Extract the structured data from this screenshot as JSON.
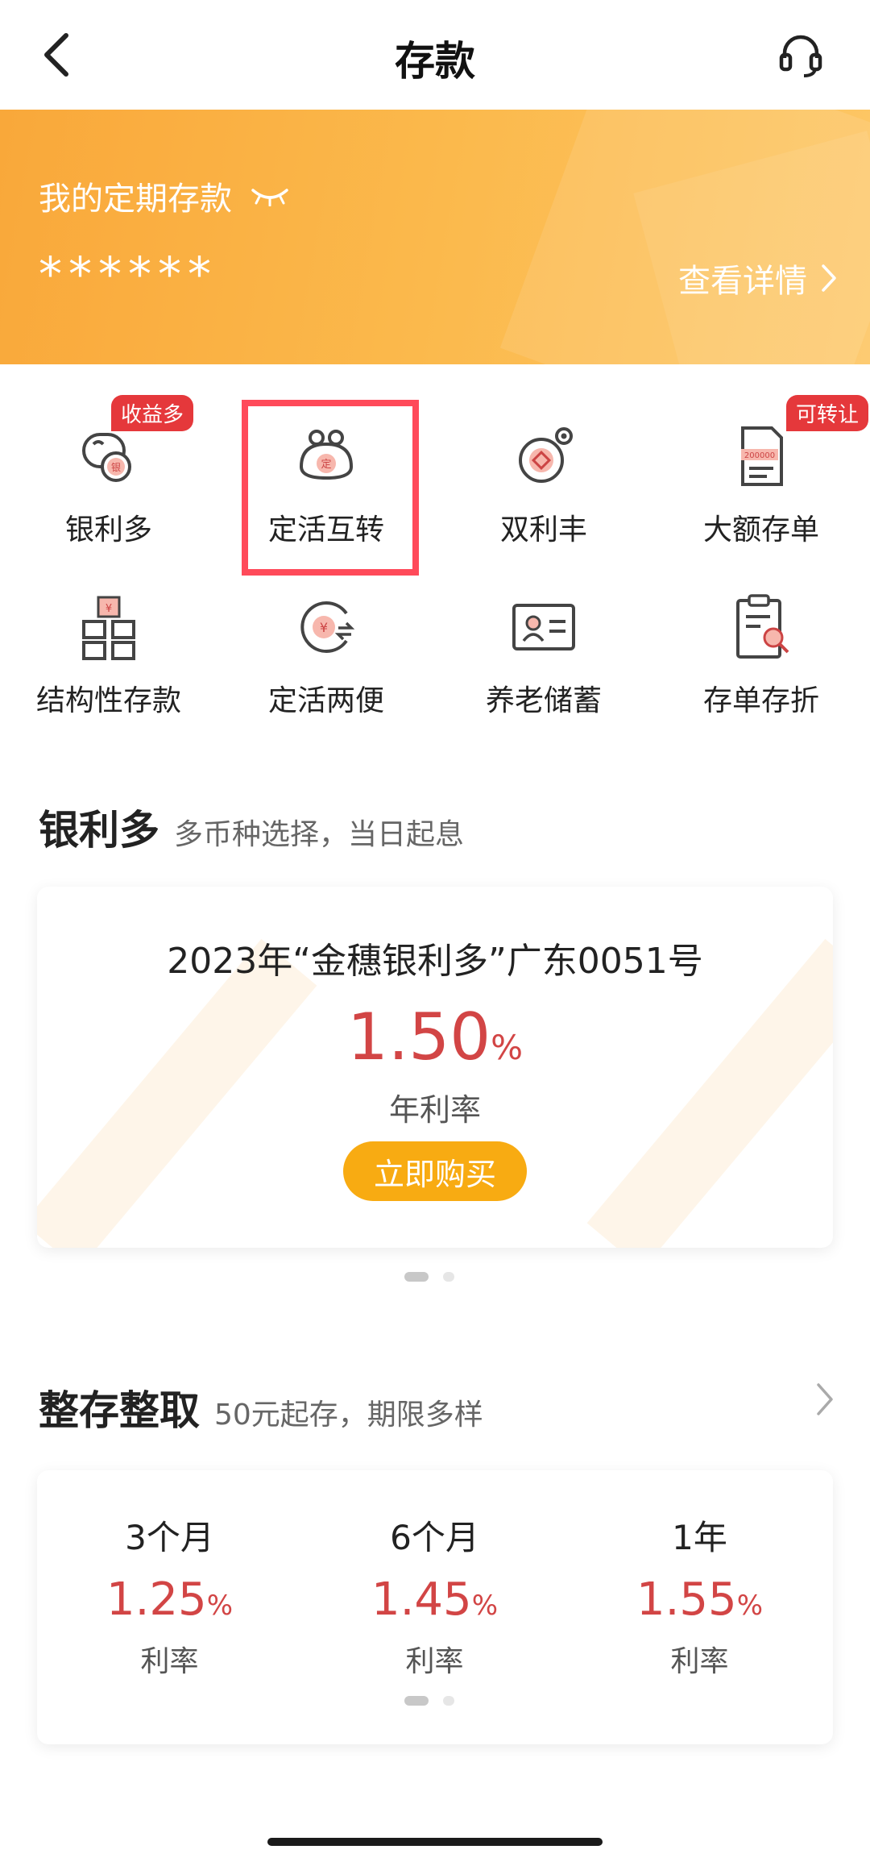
{
  "header": {
    "title": "存款",
    "back_icon": "chevron-left-icon",
    "service_icon": "headset-icon"
  },
  "banner": {
    "label": "我的定期存款",
    "masked_amount": "******",
    "detail_link": "查看详情",
    "eye_icon": "eye-closed-icon"
  },
  "grid": {
    "items": [
      {
        "label": "银利多",
        "icon": "coin-silver-icon",
        "badge": "收益多"
      },
      {
        "label": "定活互转",
        "icon": "purse-icon",
        "badge": ""
      },
      {
        "label": "双利丰",
        "icon": "coins-icon",
        "badge": ""
      },
      {
        "label": "大额存单",
        "icon": "certificate-icon",
        "badge": "可转让"
      },
      {
        "label": "结构性存款",
        "icon": "structure-icon",
        "badge": ""
      },
      {
        "label": "定活两便",
        "icon": "yuan-exchange-icon",
        "badge": ""
      },
      {
        "label": "养老储蓄",
        "icon": "id-card-icon",
        "badge": ""
      },
      {
        "label": "存单存折",
        "icon": "document-search-icon",
        "badge": ""
      }
    ]
  },
  "section1": {
    "title": "银利多",
    "subtitle": "多币种选择，当日起息",
    "product_name": "2023年“金穗银利多”广东0051号",
    "rate_value": "1.50",
    "rate_unit": "%",
    "rate_label": "年利率",
    "buy_label": "立即购买"
  },
  "section2": {
    "title": "整存整取",
    "subtitle": "50元起存，期限多样",
    "terms": [
      {
        "name": "3个月",
        "rate": "1.25",
        "unit": "%",
        "label": "利率"
      },
      {
        "name": "6个月",
        "rate": "1.45",
        "unit": "%",
        "label": "利率"
      },
      {
        "name": "1年",
        "rate": "1.55",
        "unit": "%",
        "label": "利率"
      }
    ]
  },
  "colors": {
    "banner_start": "#f9a83a",
    "banner_end": "#fdc766",
    "accent_red": "#d24545",
    "badge_red": "#e5383b",
    "button_orange": "#f8ab12",
    "highlight_box": "#ff4a5a"
  }
}
